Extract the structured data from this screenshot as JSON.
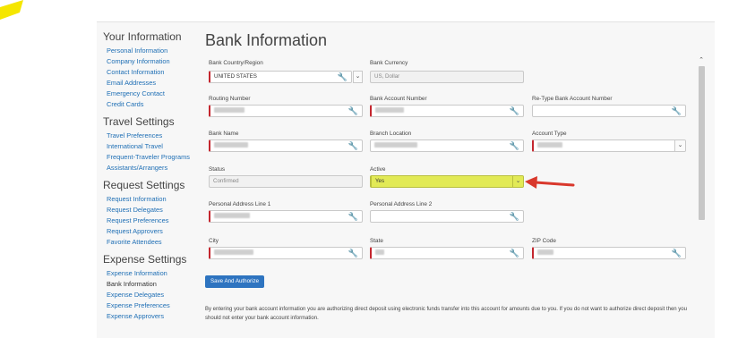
{
  "sidebar": {
    "sections": [
      {
        "heading": "Your Information",
        "items": [
          "Personal Information",
          "Company Information",
          "Contact Information",
          "Email Addresses",
          "Emergency Contact",
          "Credit Cards"
        ]
      },
      {
        "heading": "Travel Settings",
        "items": [
          "Travel Preferences",
          "International Travel",
          "Frequent-Traveler Programs",
          "Assistants/Arrangers"
        ]
      },
      {
        "heading": "Request Settings",
        "items": [
          "Request Information",
          "Request Delegates",
          "Request Preferences",
          "Request Approvers",
          "Favorite Attendees"
        ]
      },
      {
        "heading": "Expense Settings",
        "items": [
          "Expense Information",
          "Bank Information",
          "Expense Delegates",
          "Expense Preferences",
          "Expense Approvers"
        ]
      }
    ],
    "active_item": "Bank Information"
  },
  "page": {
    "title": "Bank Information"
  },
  "form": {
    "country_label": "Bank Country/Region",
    "country_value": "UNITED STATES",
    "currency_label": "Bank Currency",
    "currency_value": "US, Dollar",
    "routing_label": "Routing Number",
    "account_label": "Bank Account Number",
    "retype_label": "Re-Type Bank Account Number",
    "bank_name_label": "Bank Name",
    "branch_label": "Branch Location",
    "account_type_label": "Account Type",
    "status_label": "Status",
    "status_value": "Confirmed",
    "active_label": "Active",
    "active_value": "Yes",
    "addr1_label": "Personal Address Line 1",
    "addr2_label": "Personal Address Line 2",
    "city_label": "City",
    "state_label": "State",
    "zip_label": "ZIP Code",
    "submit_label": "Save And Authorize",
    "disclaimer": "By entering your bank account information you are authorizing direct deposit using electronic funds transfer into this account for amounts due to you. If you do not want to authorize direct deposit then you should not enter your bank account information."
  },
  "colors": {
    "brand_yellow": "#f5e600",
    "link_blue": "#1f6fb5",
    "button_blue": "#2e74c0",
    "required_red": "#c4262e",
    "highlight_yellow": "#e2ea56",
    "arrow_red": "#d9382c"
  },
  "icons": {
    "wrench": "wrench-icon",
    "caret": "chevron-down-icon",
    "scroll_up": "chevron-up-icon"
  }
}
